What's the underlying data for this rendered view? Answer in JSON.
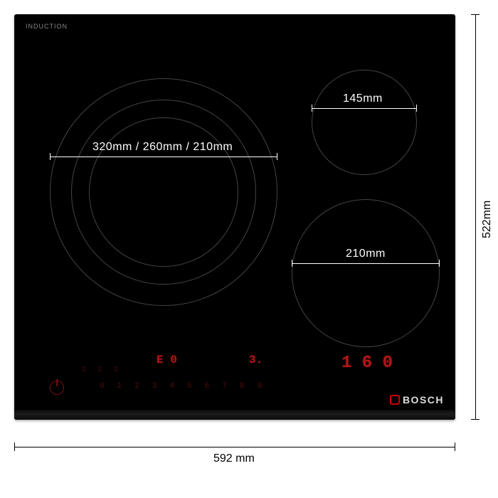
{
  "product": {
    "top_label": "INDUCTION",
    "top_sublabel": "",
    "brand": "BOSCH"
  },
  "zones": {
    "triple": {
      "label": "320mm / 260mm / 210mm"
    },
    "small": {
      "label": "145mm"
    },
    "medium": {
      "label": "210mm"
    }
  },
  "dimensions": {
    "width": "592 mm",
    "height": "522mm"
  },
  "controls": {
    "disp_left": "E   0",
    "disp_mid": "3.",
    "disp_right": "1 6 0",
    "slider": [
      "0",
      "1",
      "2",
      "3",
      "4",
      "5",
      "6",
      "7",
      "8",
      "9"
    ]
  }
}
